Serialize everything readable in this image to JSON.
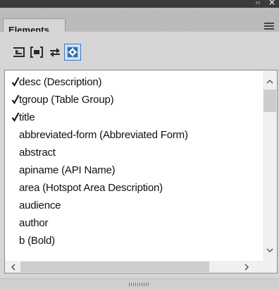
{
  "panel": {
    "collapse_glyph": "‹‹",
    "close_glyph": "×",
    "tab_label": "Elements"
  },
  "toolbar": {
    "buttons": [
      {
        "icon": "insert-element-icon"
      },
      {
        "icon": "wrap-element-icon"
      },
      {
        "icon": "change-element-icon"
      },
      {
        "icon": "settings-icon",
        "active": true
      }
    ]
  },
  "elements": [
    {
      "label": "desc  (Description)",
      "checked": true
    },
    {
      "label": "tgroup  (Table Group)",
      "checked": true
    },
    {
      "label": "title",
      "checked": true
    },
    {
      "label": "abbreviated-form  (Abbreviated Form)",
      "checked": false
    },
    {
      "label": "abstract",
      "checked": false
    },
    {
      "label": "apiname  (API Name)",
      "checked": false
    },
    {
      "label": "area  (Hotspot Area Description)",
      "checked": false
    },
    {
      "label": "audience",
      "checked": false
    },
    {
      "label": "author",
      "checked": false
    },
    {
      "label": "b  (Bold)",
      "checked": false
    }
  ],
  "colors": {
    "accent": "#3a78c2",
    "title_bar": "#3b3b3b",
    "panel_bg": "#d6d6d6"
  }
}
